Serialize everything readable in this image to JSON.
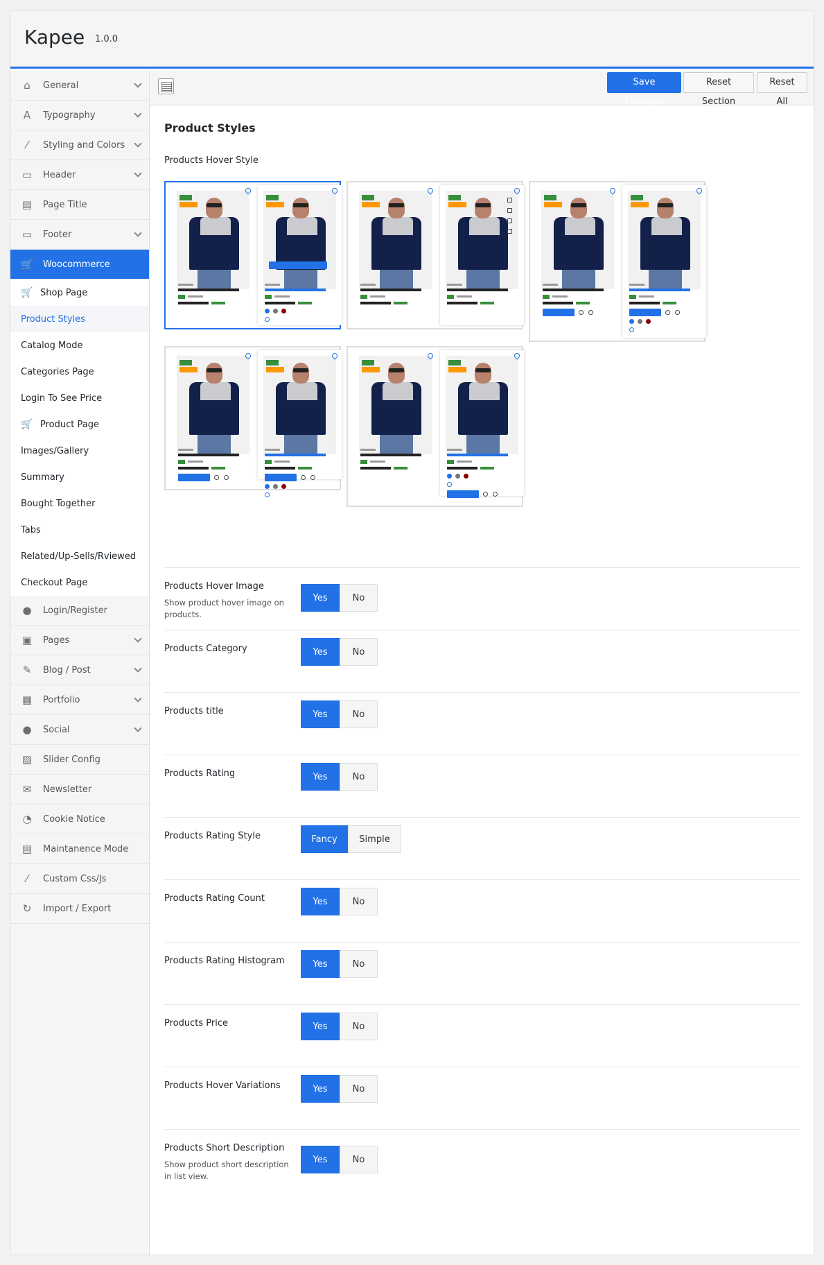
{
  "app": {
    "title": "Kapee",
    "version": "1.0.0"
  },
  "toolbar": {
    "save": "Save Changes",
    "reset_section": "Reset Section",
    "reset_all": "Reset All"
  },
  "sidebar": {
    "items": [
      {
        "label": "General",
        "icon": "home-icon",
        "chevron": true
      },
      {
        "label": "Typography",
        "icon": "typography-icon",
        "chevron": true
      },
      {
        "label": "Styling and Colors",
        "icon": "brush-icon",
        "chevron": true
      },
      {
        "label": "Header",
        "icon": "header-icon",
        "chevron": true
      },
      {
        "label": "Page Title",
        "icon": "page-title-icon",
        "chevron": false
      },
      {
        "label": "Footer",
        "icon": "footer-icon",
        "chevron": true
      },
      {
        "label": "Woocommerce",
        "icon": "cart-icon",
        "chevron": false
      }
    ],
    "sub_items": [
      {
        "label": "Shop Page",
        "icon": "cart-icon"
      },
      {
        "label": "Product Styles"
      },
      {
        "label": "Catalog Mode"
      },
      {
        "label": "Categories Page"
      },
      {
        "label": "Login To See Price"
      },
      {
        "label": "Product Page",
        "icon": "cart-icon"
      },
      {
        "label": "Images/Gallery"
      },
      {
        "label": "Summary"
      },
      {
        "label": "Bought Together"
      },
      {
        "label": "Tabs"
      },
      {
        "label": "Related/Up-Sells/Rviewed"
      },
      {
        "label": "Checkout Page"
      }
    ],
    "items_after": [
      {
        "label": "Login/Register",
        "icon": "user-icon",
        "chevron": false
      },
      {
        "label": "Pages",
        "icon": "pages-icon",
        "chevron": true
      },
      {
        "label": "Blog / Post",
        "icon": "edit-icon",
        "chevron": true
      },
      {
        "label": "Portfolio",
        "icon": "grid-icon",
        "chevron": true
      },
      {
        "label": "Social",
        "icon": "group-icon",
        "chevron": true
      },
      {
        "label": "Slider Config",
        "icon": "image-icon",
        "chevron": false
      },
      {
        "label": "Newsletter",
        "icon": "mail-icon",
        "chevron": false
      },
      {
        "label": "Cookie Notice",
        "icon": "cookie-icon",
        "chevron": false
      },
      {
        "label": "Maintanence Mode",
        "icon": "maintenance-icon",
        "chevron": false
      },
      {
        "label": "Custom Css/Js",
        "icon": "code-icon",
        "chevron": false
      },
      {
        "label": "Import / Export",
        "icon": "refresh-icon",
        "chevron": false
      }
    ]
  },
  "main": {
    "section_title": "Product Styles",
    "hover_style_label": "Products Hover Style",
    "hover_style_options": 5,
    "selected_hover_style": 1,
    "settings": [
      {
        "label": "Products Hover Image",
        "desc": "Show product hover image on products.",
        "options": [
          "Yes",
          "No"
        ],
        "selected": "Yes"
      },
      {
        "label": "Products Category",
        "options": [
          "Yes",
          "No"
        ],
        "selected": "Yes"
      },
      {
        "label": "Products title",
        "options": [
          "Yes",
          "No"
        ],
        "selected": "Yes"
      },
      {
        "label": "Products Rating",
        "options": [
          "Yes",
          "No"
        ],
        "selected": "Yes"
      },
      {
        "label": "Products Rating Style",
        "options": [
          "Fancy",
          "Simple"
        ],
        "selected": "Fancy"
      },
      {
        "label": "Products Rating Count",
        "options": [
          "Yes",
          "No"
        ],
        "selected": "Yes"
      },
      {
        "label": "Products Rating Histogram",
        "options": [
          "Yes",
          "No"
        ],
        "selected": "Yes"
      },
      {
        "label": "Products Price",
        "options": [
          "Yes",
          "No"
        ],
        "selected": "Yes"
      },
      {
        "label": "Products Hover Variations",
        "options": [
          "Yes",
          "No"
        ],
        "selected": "Yes"
      },
      {
        "label": "Products Short Description",
        "desc": "Show product short description in list view.",
        "options": [
          "Yes",
          "No"
        ],
        "selected": "Yes"
      }
    ]
  },
  "colors": {
    "accent": "#2271e6",
    "badge_new": "#388e3c",
    "badge_featured": "#ff9800"
  }
}
